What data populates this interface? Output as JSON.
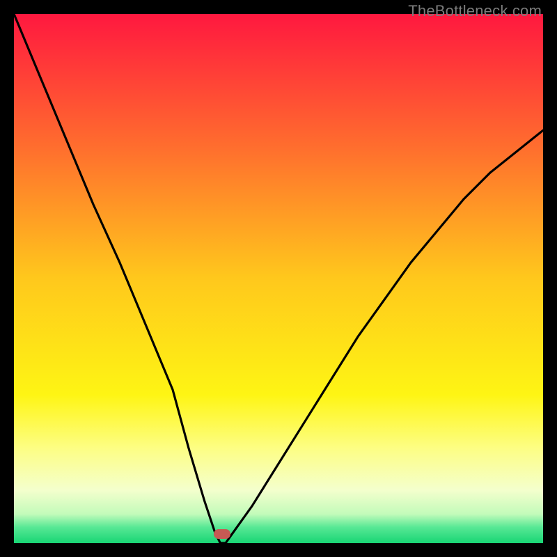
{
  "watermark": "TheBottleneck.com",
  "chart_data": {
    "type": "line",
    "title": "",
    "xlabel": "",
    "ylabel": "",
    "xlim": [
      0,
      100
    ],
    "ylim": [
      0,
      100
    ],
    "x": [
      0,
      5,
      10,
      15,
      20,
      25,
      30,
      33,
      36,
      38,
      39,
      40,
      45,
      50,
      55,
      60,
      65,
      70,
      75,
      80,
      85,
      90,
      95,
      100
    ],
    "y": [
      100,
      88,
      76,
      64,
      53,
      41,
      29,
      18,
      8,
      2,
      0,
      0,
      7,
      15,
      23,
      31,
      39,
      46,
      53,
      59,
      65,
      70,
      74,
      78
    ],
    "minimum_x": 39,
    "gradient_stops": [
      {
        "offset": 0.0,
        "color": "#ff183f"
      },
      {
        "offset": 0.25,
        "color": "#ff6d2e"
      },
      {
        "offset": 0.5,
        "color": "#ffc81c"
      },
      {
        "offset": 0.72,
        "color": "#fef514"
      },
      {
        "offset": 0.82,
        "color": "#fdfe83"
      },
      {
        "offset": 0.9,
        "color": "#f4ffcd"
      },
      {
        "offset": 0.945,
        "color": "#c3fbba"
      },
      {
        "offset": 0.97,
        "color": "#58e895"
      },
      {
        "offset": 1.0,
        "color": "#18d574"
      }
    ],
    "marker": {
      "x_pct": 39.3,
      "y_pct": 98.3,
      "color": "#c65a54"
    }
  }
}
